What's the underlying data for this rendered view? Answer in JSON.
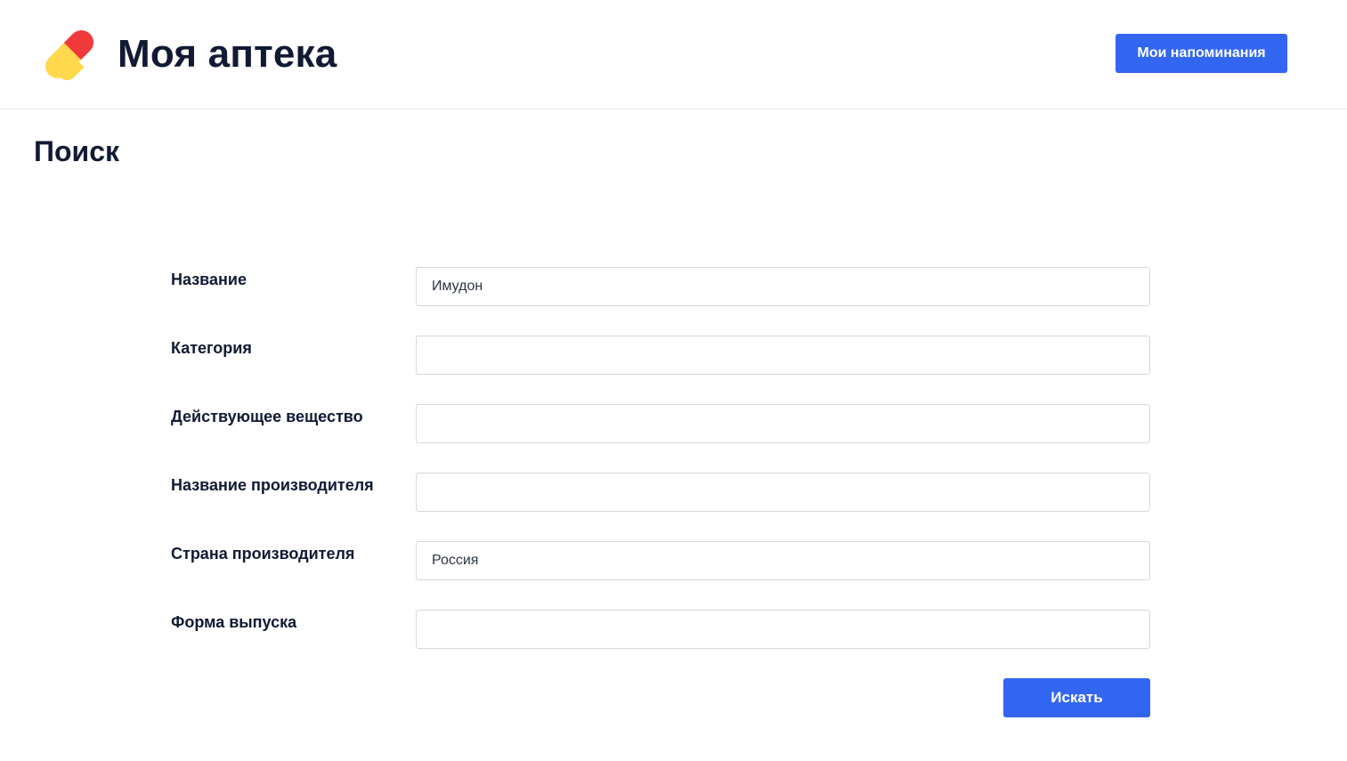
{
  "header": {
    "logo_icon": "pill-capsule-icon",
    "app_title": "Моя аптека",
    "reminders_button_label": "Мои напоминания"
  },
  "page": {
    "title": "Поиск"
  },
  "form": {
    "fields": [
      {
        "label": "Название",
        "value": "Имудон",
        "placeholder": ""
      },
      {
        "label": "Категория",
        "value": "",
        "placeholder": ""
      },
      {
        "label": "Действующее вещество",
        "value": "",
        "placeholder": ""
      },
      {
        "label": "Название производителя",
        "value": "",
        "placeholder": ""
      },
      {
        "label": "Страна производителя",
        "value": "Россия",
        "placeholder": ""
      },
      {
        "label": "Форма выпуска",
        "value": "",
        "placeholder": ""
      }
    ],
    "submit_label": "Искать"
  },
  "colors": {
    "accent": "#3366f0",
    "text_dark": "#101a33",
    "pill_red": "#f0393a",
    "pill_yellow": "#ffd84d",
    "input_border": "#d4d7dc"
  }
}
